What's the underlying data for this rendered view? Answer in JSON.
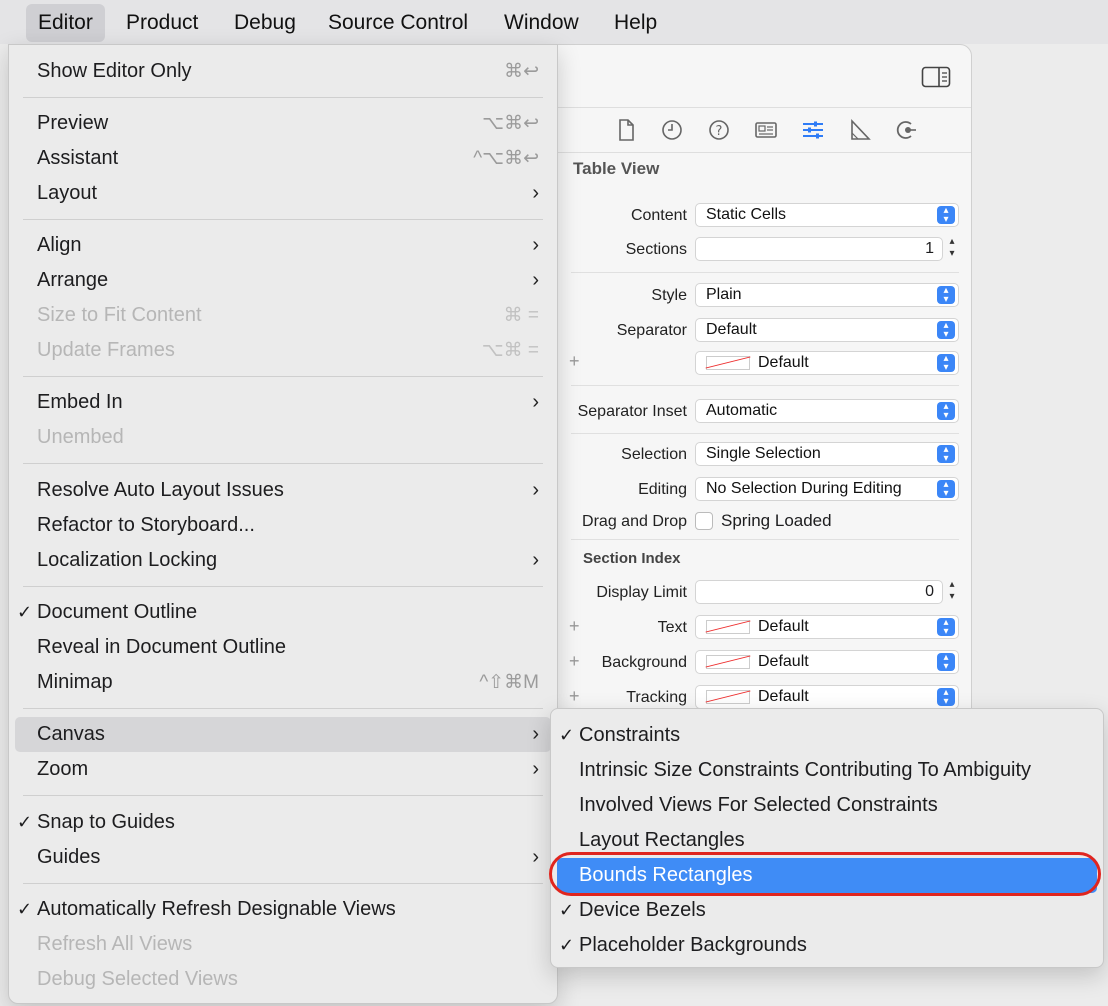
{
  "menubar": {
    "items": [
      "Editor",
      "Product",
      "Debug",
      "Source Control",
      "Window",
      "Help"
    ]
  },
  "inspector": {
    "title": "Table View",
    "content_label": "Content",
    "content_value": "Static Cells",
    "sections_label": "Sections",
    "sections_value": "1",
    "style_label": "Style",
    "style_value": "Plain",
    "separator_label": "Separator",
    "separator_value": "Default",
    "separator_color_value": "Default",
    "separator_inset_label": "Separator Inset",
    "separator_inset_value": "Automatic",
    "selection_label": "Selection",
    "selection_value": "Single Selection",
    "editing_label": "Editing",
    "editing_value": "No Selection During Editing",
    "drag_drop_label": "Drag and Drop",
    "drag_drop_value": "Spring Loaded",
    "section_index_title": "Section Index",
    "display_limit_label": "Display Limit",
    "display_limit_value": "0",
    "text_label": "Text",
    "text_value": "Default",
    "background_label": "Background",
    "background_value": "Default",
    "tracking_label": "Tracking",
    "tracking_value": "Default",
    "accent_color": "#3b86f7"
  },
  "editor_menu": {
    "show_editor_only": "Show Editor Only",
    "show_editor_only_sc": "⌘↩",
    "preview": "Preview",
    "preview_sc": "⌥⌘↩",
    "assistant": "Assistant",
    "assistant_sc": "^⌥⌘↩",
    "layout": "Layout",
    "align": "Align",
    "arrange": "Arrange",
    "size_to_fit": "Size to Fit Content",
    "size_to_fit_sc": "⌘ =",
    "update_frames": "Update Frames",
    "update_frames_sc": "⌥⌘ =",
    "embed_in": "Embed In",
    "unembed": "Unembed",
    "resolve_auto_layout": "Resolve Auto Layout Issues",
    "refactor_storyboard": "Refactor to Storyboard...",
    "localization_locking": "Localization Locking",
    "document_outline": "Document Outline",
    "reveal_outline": "Reveal in Document Outline",
    "minimap": "Minimap",
    "minimap_sc": "^⇧⌘M",
    "canvas": "Canvas",
    "zoom": "Zoom",
    "snap_guides": "Snap to Guides",
    "guides": "Guides",
    "auto_refresh": "Automatically Refresh Designable Views",
    "refresh_all": "Refresh All Views",
    "debug_selected": "Debug Selected Views"
  },
  "canvas_menu": {
    "constraints": "Constraints",
    "intrinsic": "Intrinsic Size Constraints Contributing To Ambiguity",
    "involved_views": "Involved Views For Selected Constraints",
    "layout_rects": "Layout Rectangles",
    "bounds_rects": "Bounds Rectangles",
    "device_bezels": "Device Bezels",
    "placeholder_bg": "Placeholder Backgrounds"
  },
  "glyphs": {
    "check": "✓",
    "chevron": "›"
  },
  "highlight_color": "#3f8cf6",
  "ring_color": "#e0251e"
}
